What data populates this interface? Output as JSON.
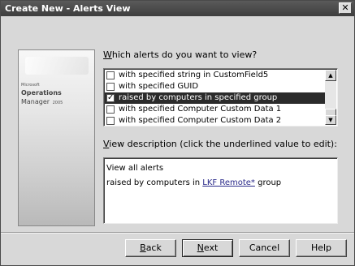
{
  "window": {
    "title": "Create New - Alerts View",
    "close_glyph": "✕"
  },
  "banner": {
    "brand_small": "Microsoft",
    "product_line1": "Operations",
    "product_line2": "Manager",
    "product_year": "2005"
  },
  "criteria": {
    "prompt_mnemonic": "W",
    "prompt_rest": "hich alerts do you want to view?",
    "items": [
      {
        "label": "with specified string in CustomField5",
        "checked": false,
        "selected": false
      },
      {
        "label": "with specified GUID",
        "checked": false,
        "selected": false
      },
      {
        "label": "raised by computers in specified group",
        "checked": true,
        "selected": true
      },
      {
        "label": "with specified Computer Custom Data 1",
        "checked": false,
        "selected": false
      },
      {
        "label": "with specified Computer Custom Data 2",
        "checked": false,
        "selected": false
      }
    ]
  },
  "description": {
    "label_mnemonic": "V",
    "label_rest": "iew description (click the underlined value to edit):",
    "line1": "View all alerts",
    "line2_prefix": "raised by computers in ",
    "line2_link": "LKF Remote*",
    "line2_suffix": " group"
  },
  "buttons": {
    "back": {
      "mnemonic": "B",
      "rest": "ack"
    },
    "next": {
      "mnemonic": "N",
      "rest": "ext"
    },
    "cancel": "Cancel",
    "help": "Help"
  }
}
